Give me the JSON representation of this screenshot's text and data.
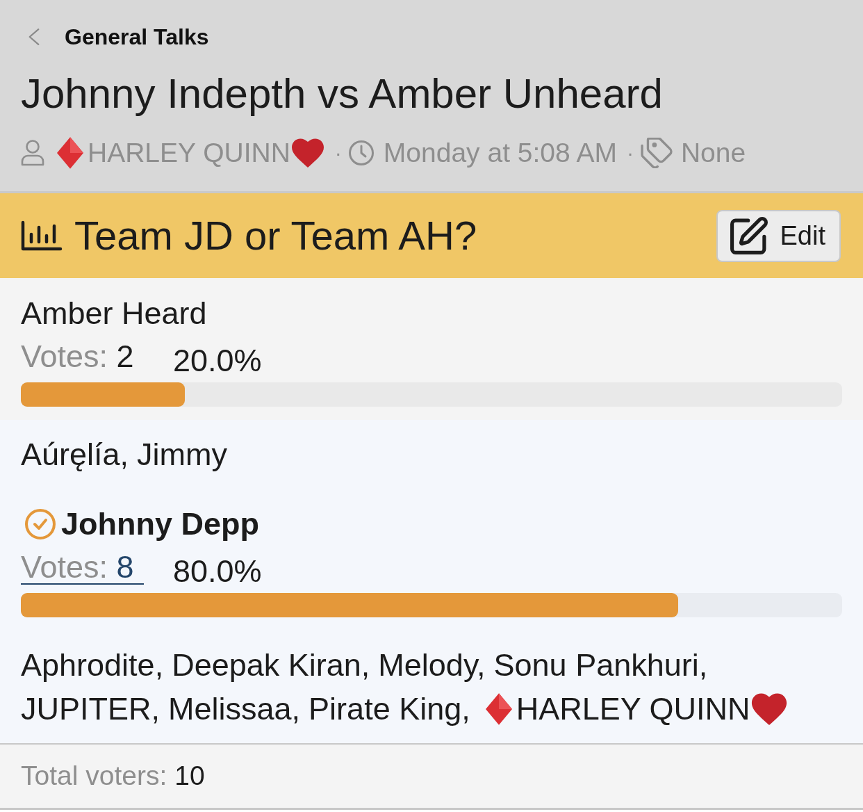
{
  "nav": {
    "breadcrumb": "General Talks"
  },
  "thread": {
    "title": "Johnny Indepth vs Amber Unheard",
    "author": "HARLEY QUINN",
    "author_decorated": true,
    "separator_1": "·",
    "date": "Monday at 5:08 AM",
    "separator_2": "·",
    "tags": "None"
  },
  "poll": {
    "question": "Team JD or Team AH?",
    "edit_button": "Edit",
    "options": [
      {
        "name": "Amber Heard",
        "voted": false,
        "votes_label": "Votes:",
        "votes": "2",
        "votes_linked": false,
        "percent": "20.0%",
        "level": 0.2,
        "voters": [
          {
            "name": "Aúręlía,",
            "decorated": false
          },
          {
            "name": "Jimmy",
            "decorated": false
          }
        ]
      },
      {
        "name": "Johnny Depp",
        "voted": true,
        "votes_label": "Votes:",
        "votes": "8",
        "votes_linked": true,
        "percent": "80.0%",
        "level": 0.8,
        "voters": [
          {
            "name": "Aphrodite,",
            "decorated": false
          },
          {
            "name": "Deepak Kiran,",
            "decorated": false
          },
          {
            "name": "Melody,",
            "decorated": false
          },
          {
            "name": "Sonu Pankhuri,",
            "decorated": false
          },
          {
            "name": "JUPITER,",
            "decorated": false
          },
          {
            "name": "Melissaa,",
            "decorated": false
          },
          {
            "name": "Pirate King,",
            "decorated": false
          },
          {
            "name": "HARLEY QUINN",
            "decorated": true
          }
        ]
      }
    ],
    "total_label": "Total voters:",
    "total": "10"
  }
}
